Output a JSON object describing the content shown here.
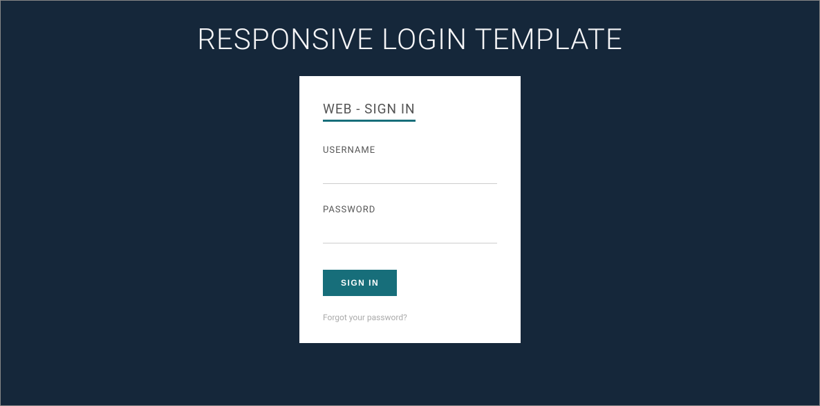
{
  "page": {
    "title": "RESPONSIVE LOGIN TEMPLATE"
  },
  "card": {
    "title": "WEB - SIGN IN",
    "fields": {
      "username": {
        "label": "USERNAME",
        "value": ""
      },
      "password": {
        "label": "PASSWORD",
        "value": ""
      }
    },
    "button": "SIGN IN",
    "forgot": "Forgot your password?"
  },
  "colors": {
    "background": "#15273a",
    "accent": "#176e7a",
    "card": "#ffffff"
  }
}
